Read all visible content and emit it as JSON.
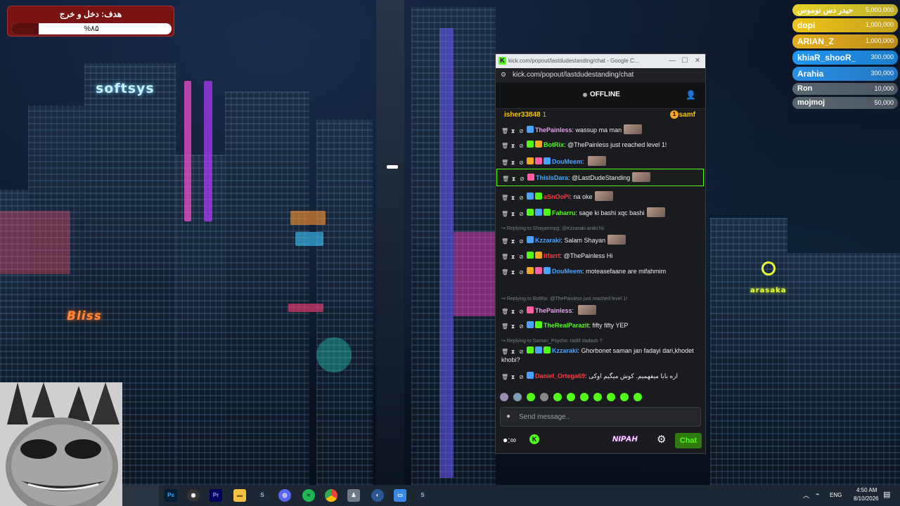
{
  "goal": {
    "title": "هدف: دخل و خرج",
    "percent_label": "%۸۵",
    "progress": 0.17
  },
  "leaderboard": [
    {
      "name": "حیدر دس نوموس",
      "value": "5,000,000",
      "color": "#e8d32a"
    },
    {
      "name": "dopi",
      "value": "1,000,000",
      "color": "#f0c419"
    },
    {
      "name": "ARIAN_Z",
      "value": "1,000,000",
      "color": "#e6ad1a"
    },
    {
      "name": "khiaR_shooR_",
      "value": "300,000",
      "color": "#2196f3"
    },
    {
      "name": "Arahia",
      "value": "300,000",
      "color": "#2a8fe6"
    },
    {
      "name": "Ron",
      "value": "10,000",
      "color": "#5c6670"
    },
    {
      "name": "mojmoj",
      "value": "50,000",
      "color": "#5c6670"
    }
  ],
  "window": {
    "title": "kick.com/popout/lastdudestanding/chat - Google C...",
    "url": "kick.com/popout/lastdudestanding/chat",
    "min": "—",
    "max": "☐",
    "close": "✕"
  },
  "chat": {
    "status": "OFFLINE",
    "pinned_user": "isher33848",
    "pinned_count": "1",
    "pinned_right": "samf",
    "coin": "1",
    "messages": [
      {
        "user": "ThePainless",
        "color": "#e8a0f0",
        "text": "wassup ma man",
        "emote": true
      },
      {
        "user": "BotRix",
        "color": "#53fc18",
        "text": "@ThePainless just reached level 1!",
        "emote": false
      },
      {
        "user": "DouMeem",
        "color": "#4aa3ff",
        "text": "",
        "emote": true
      },
      {
        "user": "ThisIsDara",
        "color": "#4aa3ff",
        "text": "@LastDudeStanding",
        "emote": true,
        "highlight": true
      },
      {
        "user": "aSnOoPi",
        "color": "#ff3b3b",
        "text": "na oke",
        "emote": true
      },
      {
        "user": "Faharru",
        "color": "#53fc18",
        "text": "sage ki bashi xqc bashi",
        "emote": true
      },
      {
        "user": "Kzzaraki",
        "color": "#4aa3ff",
        "text": "Salam Shayan",
        "emote": true
      },
      {
        "user": "itfarrt",
        "color": "#ff3b3b",
        "text": "@ThePainless Hi",
        "emote": false
      },
      {
        "user": "DouMeem",
        "color": "#4aa3ff",
        "text": "moteasefaane are mifahmim",
        "emote": false
      },
      {
        "user": "ThePainless",
        "color": "#e8a0f0",
        "text": "",
        "emote": true
      },
      {
        "user": "TheRealParazit",
        "color": "#53fc18",
        "text": "fifty fifty YEP",
        "emote": false
      },
      {
        "user": "Kzzaraki",
        "color": "#4aa3ff",
        "text": "Ghorbonet saman jan fadayi dari,khodet khobi?",
        "emote": false
      },
      {
        "user": "Daniel_Ortega69",
        "color": "#ff3b3b",
        "text": "اره بابا میفهمیم. کوش میگیم اوکی",
        "emote": false
      }
    ],
    "replies": [
      "Replying to Shayanmpg: @Kzzaraki araki hii",
      "Replying to BotRix: @ThePainless just reached level 1!",
      "Replying to Saman_Psycho: radifi dadash ?"
    ],
    "input_placeholder": "Send message..",
    "brand": "NIPAH",
    "chat_button": "Chat",
    "k_logo": "K",
    "infinity": "∞"
  },
  "taskbar": {
    "lang": "ENG",
    "time": "4:50 AM",
    "date": "8/10/2026",
    "apps": [
      "Ps",
      "Pr"
    ]
  },
  "signs": {
    "softsys": "softsys",
    "arasaka": "arasaka",
    "bliss": "Bliss"
  },
  "colors": {
    "kick_green": "#53fc18",
    "goal_red": "#7a1414"
  }
}
